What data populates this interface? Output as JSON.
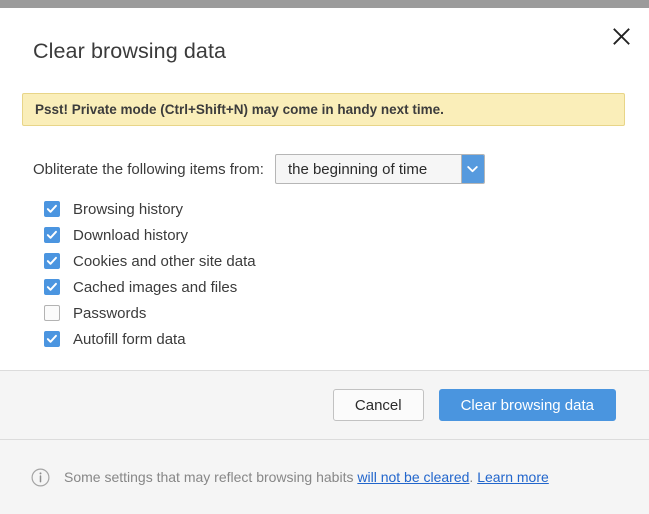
{
  "dialog": {
    "title": "Clear browsing data",
    "close_icon": "close-icon",
    "notice": {
      "text": "Psst! Private mode (Ctrl+Shift+N) may come in handy next time.",
      "background_color": "#faeeb9",
      "border_color": "#e8d588"
    },
    "range": {
      "label": "Obliterate the following items from:",
      "selected": "the beginning of time",
      "chevron_icon": "chevron-down-icon",
      "chevron_background": "#569ade"
    },
    "items": [
      {
        "label": "Browsing history",
        "checked": true
      },
      {
        "label": "Download history",
        "checked": true
      },
      {
        "label": "Cookies and other site data",
        "checked": true
      },
      {
        "label": "Cached images and files",
        "checked": true
      },
      {
        "label": "Passwords",
        "checked": false
      },
      {
        "label": "Autofill form data",
        "checked": true
      }
    ],
    "footer": {
      "cancel_label": "Cancel",
      "confirm_label": "Clear browsing data",
      "confirm_color": "#4a95df"
    },
    "info": {
      "icon": "info-circle-icon",
      "text_before": "Some settings that may reflect browsing habits ",
      "link_primary": "will not be cleared",
      "text_middle": ". ",
      "link_secondary": "Learn more",
      "link_color": "#2266cc"
    }
  },
  "accent": {
    "checkbox_checked": "#4b95e0"
  }
}
